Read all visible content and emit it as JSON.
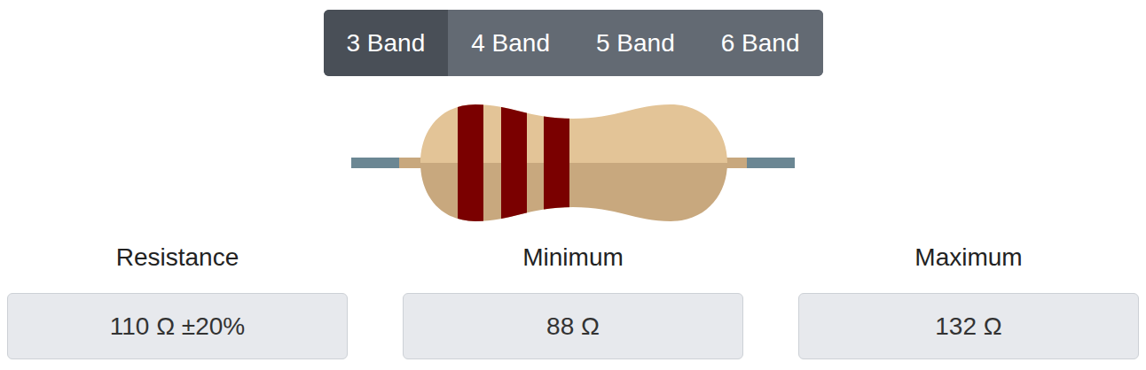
{
  "tabs": [
    {
      "label": "3 Band",
      "selected": true
    },
    {
      "label": "4 Band",
      "selected": false
    },
    {
      "label": "5 Band",
      "selected": false
    },
    {
      "label": "6 Band",
      "selected": false
    }
  ],
  "resistor": {
    "bands": [
      {
        "color": "#7a0000"
      },
      {
        "color": "#7a0000"
      },
      {
        "color": "#7a0000"
      }
    ]
  },
  "fields": [
    {
      "label": "Resistance",
      "value": "110 Ω ±20%"
    },
    {
      "label": "Minimum",
      "value": "88 Ω"
    },
    {
      "label": "Maximum",
      "value": "132 Ω"
    }
  ]
}
